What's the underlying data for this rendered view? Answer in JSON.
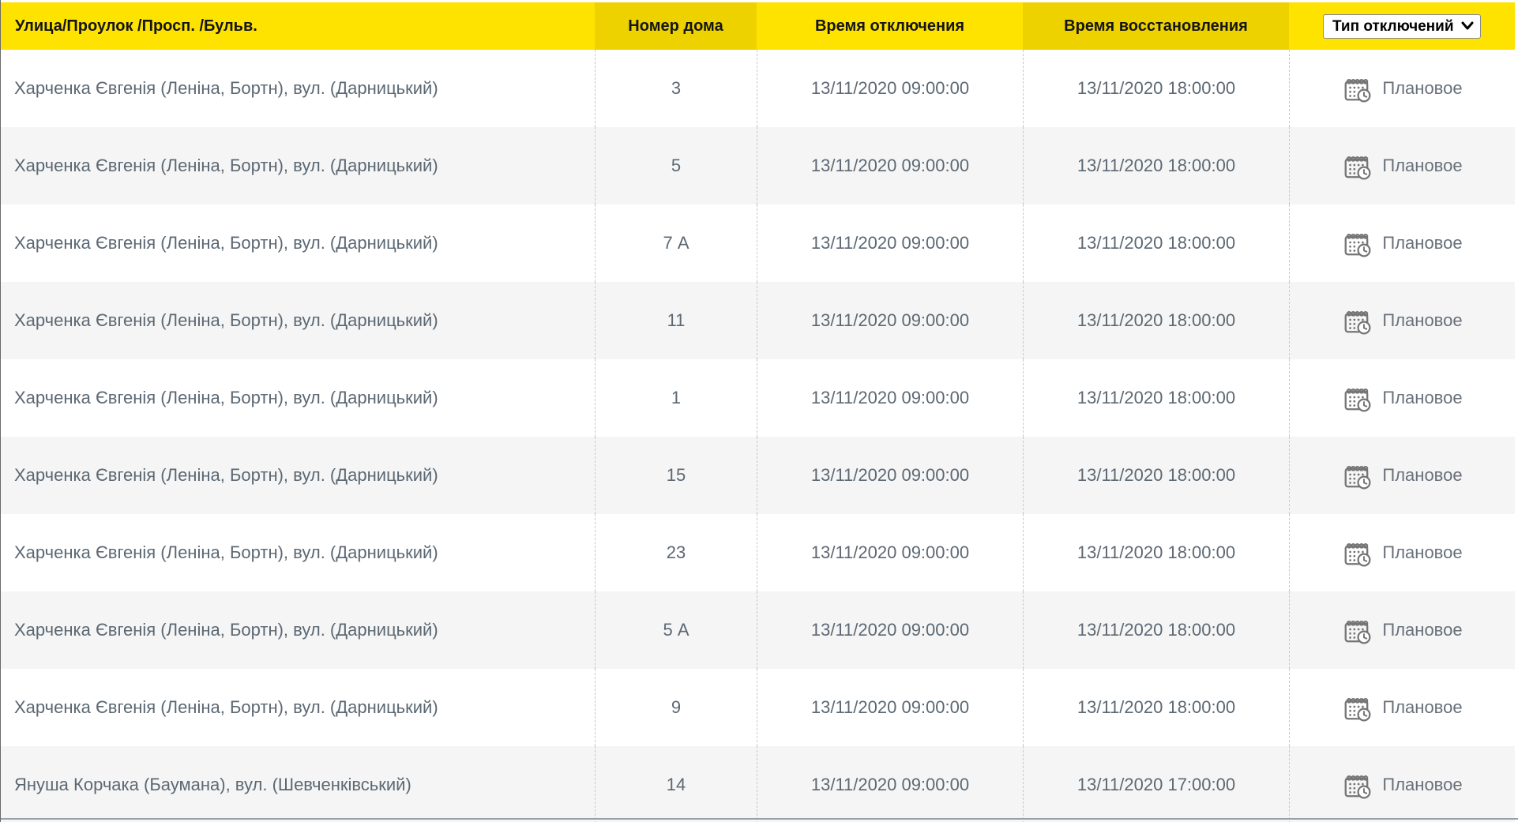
{
  "header": {
    "street": "Улица/Проулок /Просп. /Бульв.",
    "house": "Номер дома",
    "off_time": "Время отключения",
    "on_time": "Время восстановления",
    "type_filter": "Тип отключений"
  },
  "rows": [
    {
      "street": "Харченка Євгенія (Леніна, Бортн), вул. (Дарницький)",
      "house": "3",
      "off": "13/11/2020 09:00:00",
      "on": "13/11/2020 18:00:00",
      "type": "Плановое"
    },
    {
      "street": "Харченка Євгенія (Леніна, Бортн), вул. (Дарницький)",
      "house": "5",
      "off": "13/11/2020 09:00:00",
      "on": "13/11/2020 18:00:00",
      "type": "Плановое"
    },
    {
      "street": "Харченка Євгенія (Леніна, Бортн), вул. (Дарницький)",
      "house": "7 А",
      "off": "13/11/2020 09:00:00",
      "on": "13/11/2020 18:00:00",
      "type": "Плановое"
    },
    {
      "street": "Харченка Євгенія (Леніна, Бортн), вул. (Дарницький)",
      "house": "11",
      "off": "13/11/2020 09:00:00",
      "on": "13/11/2020 18:00:00",
      "type": "Плановое"
    },
    {
      "street": "Харченка Євгенія (Леніна, Бортн), вул. (Дарницький)",
      "house": "1",
      "off": "13/11/2020 09:00:00",
      "on": "13/11/2020 18:00:00",
      "type": "Плановое"
    },
    {
      "street": "Харченка Євгенія (Леніна, Бортн), вул. (Дарницький)",
      "house": "15",
      "off": "13/11/2020 09:00:00",
      "on": "13/11/2020 18:00:00",
      "type": "Плановое"
    },
    {
      "street": "Харченка Євгенія (Леніна, Бортн), вул. (Дарницький)",
      "house": "23",
      "off": "13/11/2020 09:00:00",
      "on": "13/11/2020 18:00:00",
      "type": "Плановое"
    },
    {
      "street": "Харченка Євгенія (Леніна, Бортн), вул. (Дарницький)",
      "house": "5 А",
      "off": "13/11/2020 09:00:00",
      "on": "13/11/2020 18:00:00",
      "type": "Плановое"
    },
    {
      "street": "Харченка Євгенія (Леніна, Бортн), вул. (Дарницький)",
      "house": "9",
      "off": "13/11/2020 09:00:00",
      "on": "13/11/2020 18:00:00",
      "type": "Плановое"
    },
    {
      "street": "Януша Корчака (Баумана), вул. (Шевченківський)",
      "house": "14",
      "off": "13/11/2020 09:00:00",
      "on": "13/11/2020 17:00:00",
      "type": "Плановое"
    }
  ],
  "icons": {
    "type_icon": "calendar-clock-icon",
    "select_icon": "chevron-down-icon"
  },
  "colors": {
    "header_yellow": "#ffe300",
    "header_yellow_dark": "#eed200",
    "row_alt": "#f5f5f5",
    "cell_text": "#5c6873",
    "icon_gray": "#757575"
  }
}
